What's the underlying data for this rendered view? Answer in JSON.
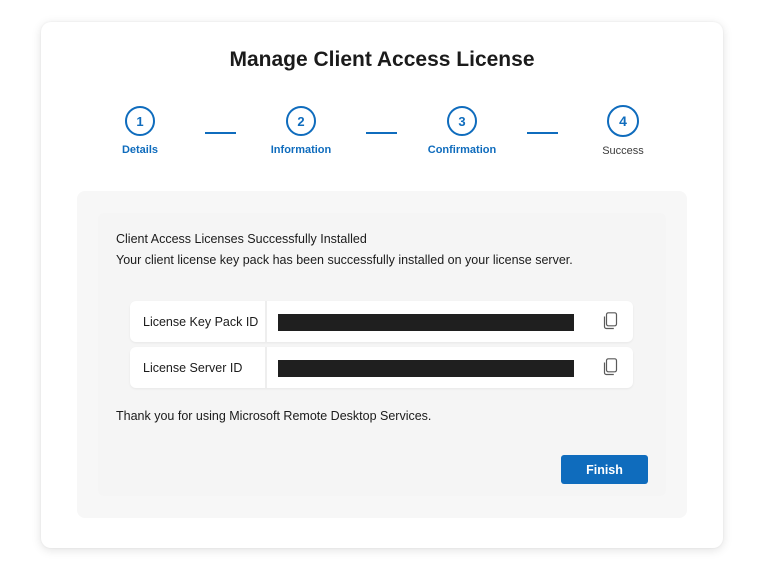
{
  "dialog": {
    "title": "Manage Client Access License"
  },
  "stepper": {
    "steps": [
      {
        "number": "1",
        "label": "Details",
        "state": "completed"
      },
      {
        "number": "2",
        "label": "Information",
        "state": "completed"
      },
      {
        "number": "3",
        "label": "Confirmation",
        "state": "completed"
      },
      {
        "number": "4",
        "label": "Success",
        "state": "current"
      }
    ]
  },
  "content": {
    "heading": "Client Access Licenses Successfully Installed",
    "description": "Your client license key pack has been successfully installed on your license server.",
    "fields": [
      {
        "label": "License Key Pack ID",
        "value_redacted": true,
        "copy_icon": "copy-icon"
      },
      {
        "label": "License Server ID",
        "value_redacted": true,
        "copy_icon": "copy-icon"
      }
    ],
    "thanks": "Thank you for using Microsoft Remote Desktop Services."
  },
  "actions": {
    "finish_label": "Finish"
  },
  "colors": {
    "accent": "#0f6cbd",
    "redaction": "#1f1f1f"
  }
}
